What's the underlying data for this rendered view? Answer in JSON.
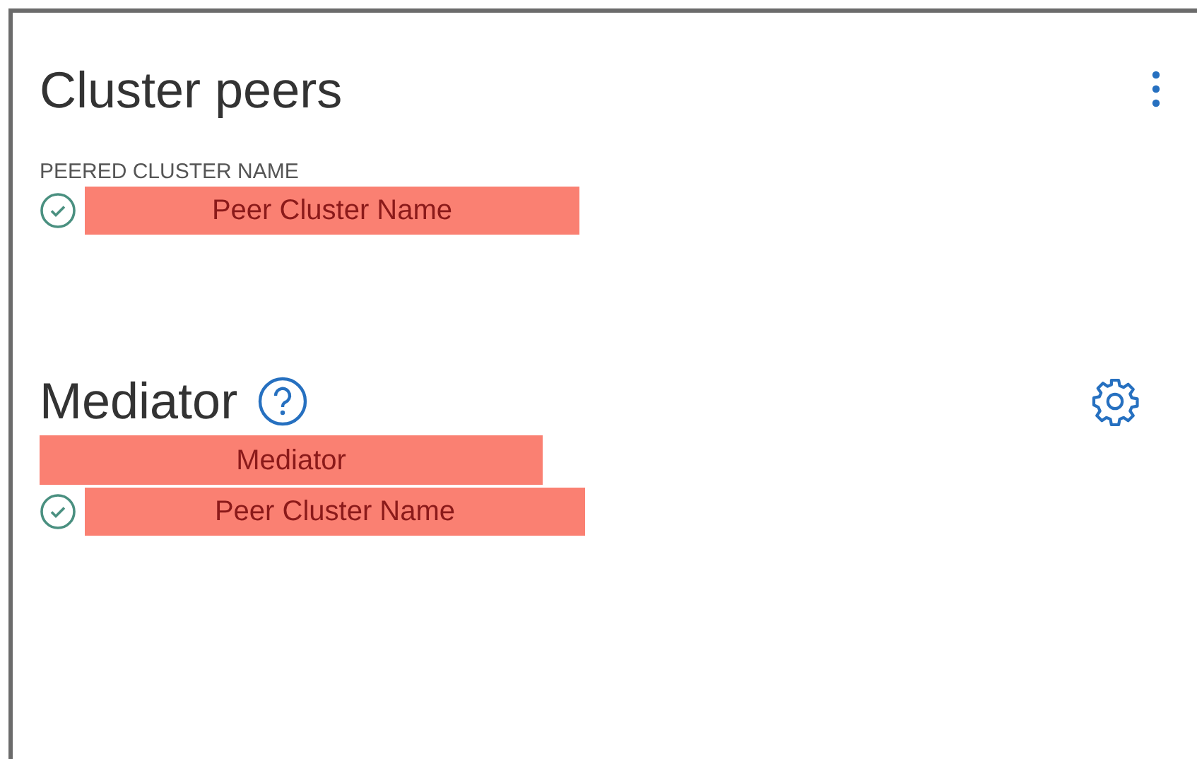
{
  "cluster_peers": {
    "title": "Cluster peers",
    "column_label": "PEERED CLUSTER NAME",
    "peers": [
      {
        "healthy": true,
        "name": "Peer Cluster Name"
      }
    ]
  },
  "mediator": {
    "title": "Mediator",
    "name": "Mediator",
    "peers": [
      {
        "healthy": true,
        "name": "Peer Cluster Name"
      }
    ]
  }
}
